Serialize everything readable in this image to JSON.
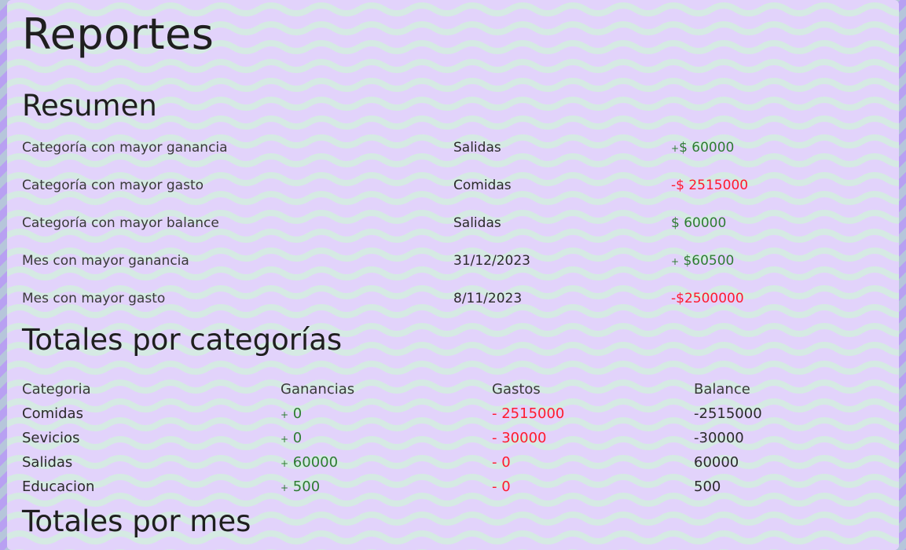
{
  "page": {
    "title": "Reportes"
  },
  "summary": {
    "heading": "Resumen",
    "rows": [
      {
        "label": "Categoría con mayor ganancia",
        "name": "Salidas",
        "sign": "+",
        "amount": "$ 60000",
        "tone": "green"
      },
      {
        "label": "Categoría con mayor gasto",
        "name": "Comidas",
        "sign": "-",
        "amount": "$ 2515000",
        "tone": "red"
      },
      {
        "label": "Categoría con mayor balance",
        "name": "Salidas",
        "sign": "",
        "amount": "$ 60000",
        "tone": "green"
      },
      {
        "label": "Mes con mayor ganancia",
        "name": "31/12/2023",
        "sign": "+",
        "amount": " $60500",
        "tone": "green"
      },
      {
        "label": "Mes con mayor gasto",
        "name": "8/11/2023",
        "sign": "-",
        "amount": "$2500000",
        "tone": "red"
      }
    ]
  },
  "totals_by_category": {
    "heading": "Totales por categorías",
    "columns": [
      "Categoria",
      "Ganancias",
      "Gastos",
      "Balance"
    ],
    "rows": [
      {
        "category": "Comidas",
        "gain_sign": "+",
        "gain": " 0",
        "expense": "- 2515000",
        "balance": "-2515000"
      },
      {
        "category": "Sevicios",
        "gain_sign": "+",
        "gain": " 0",
        "expense": "- 30000",
        "balance": "-30000"
      },
      {
        "category": "Salidas",
        "gain_sign": "+",
        "gain": " 60000",
        "expense": "- 0",
        "balance": "60000"
      },
      {
        "category": "Educacion",
        "gain_sign": "+",
        "gain": " 500",
        "expense": "- 0",
        "balance": "500"
      }
    ]
  },
  "totals_by_month": {
    "heading": "Totales por mes"
  },
  "colors": {
    "gain": "#2e7d32",
    "expense": "#ff1a2e",
    "card_background": "#e4d6fb",
    "page_background": "#b8a0f2"
  }
}
